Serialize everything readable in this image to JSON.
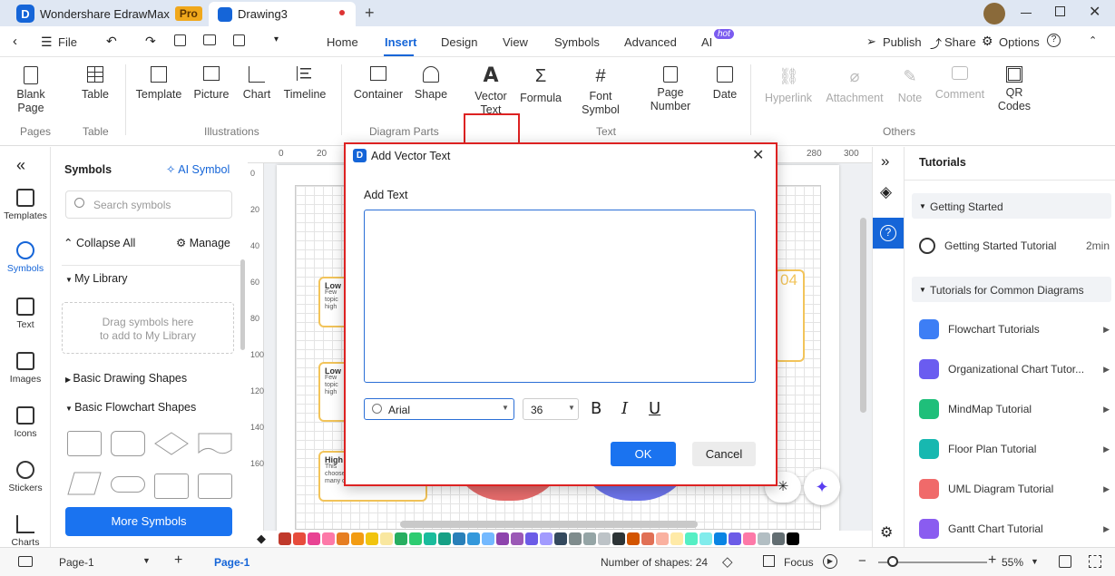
{
  "titlebar": {
    "app_name": "Wondershare EdrawMax",
    "pro_badge": "Pro",
    "doc_tab": "Drawing3",
    "new_tab": "+"
  },
  "menu": {
    "file": "File",
    "tabs": [
      "Home",
      "Insert",
      "Design",
      "View",
      "Symbols",
      "Advanced",
      "AI"
    ],
    "ai_badge": "hot",
    "publish": "Publish",
    "share": "Share",
    "options": "Options"
  },
  "ribbon": {
    "blank_page": [
      "Blank",
      "Page"
    ],
    "table": "Table",
    "template": "Template",
    "picture": "Picture",
    "chart": "Chart",
    "timeline": "Timeline",
    "container": "Container",
    "shape": "Shape",
    "vector_text": [
      "Vector",
      "Text"
    ],
    "formula": "Formula",
    "font_symbol": [
      "Font",
      "Symbol"
    ],
    "page_number": [
      "Page",
      "Number"
    ],
    "date": "Date",
    "hyperlink": "Hyperlink",
    "attachment": "Attachment",
    "note": "Note",
    "comment": "Comment",
    "qr_codes": [
      "QR",
      "Codes"
    ],
    "groups": {
      "pages": "Pages",
      "table": "Table",
      "illustrations": "Illustrations",
      "diagram_parts": "Diagram Parts",
      "text": "Text",
      "others": "Others"
    }
  },
  "leftbar": [
    "Templates",
    "Symbols",
    "Text",
    "Images",
    "Icons",
    "Stickers",
    "Charts"
  ],
  "symbols": {
    "title": "Symbols",
    "ai_symbol": "AI Symbol",
    "search_placeholder": "Search symbols",
    "collapse_all": "Collapse All",
    "manage": "Manage",
    "my_library": "My Library",
    "drop_hint": [
      "Drag symbols here",
      "to add to My Library"
    ],
    "basic_drawing": "Basic Drawing Shapes",
    "basic_flowchart": "Basic Flowchart Shapes",
    "more_symbols": "More Symbols"
  },
  "canvas": {
    "ruler_top": [
      "0",
      "20",
      "280",
      "300"
    ],
    "ruler_left": [
      "0",
      "20",
      "40",
      "60",
      "80",
      "100",
      "120",
      "140",
      "160"
    ],
    "cards": [
      {
        "title": "Low",
        "lines": [
          "Few",
          "topic",
          "high"
        ]
      },
      {
        "title": "Low",
        "lines": [
          "Few",
          "topic",
          "high"
        ]
      },
      {
        "title": "High",
        "lines": [
          "This",
          "choose this topic, you have",
          "many competitors."
        ]
      }
    ],
    "card_number": "04"
  },
  "dialog": {
    "title": "Add Vector Text",
    "label": "Add Text",
    "text_value": "",
    "font": "Arial",
    "size": "36",
    "bold": "B",
    "italic": "I",
    "underline": "U",
    "ok": "OK",
    "cancel": "Cancel"
  },
  "tutorials": {
    "title": "Tutorials",
    "getting_started_section": "Getting Started",
    "getting_started_item": "Getting Started Tutorial",
    "getting_started_duration": "2min",
    "common_section": "Tutorials for Common Diagrams",
    "items": [
      {
        "label": "Flowchart Tutorials",
        "color": "#3d7ef5"
      },
      {
        "label": "Organizational Chart Tutor...",
        "color": "#6a5cf0"
      },
      {
        "label": "MindMap Tutorial",
        "color": "#1fbf7a"
      },
      {
        "label": "Floor Plan Tutorial",
        "color": "#17b8b0"
      },
      {
        "label": "UML Diagram Tutorial",
        "color": "#f06a6a"
      },
      {
        "label": "Gantt Chart Tutorial",
        "color": "#8a5cf0"
      }
    ]
  },
  "status": {
    "page_selector": "Page-1",
    "add_page": "+",
    "active_page": "Page-1",
    "shapes_count": "Number of shapes: 24",
    "focus": "Focus",
    "zoom": "55%"
  },
  "palette": [
    "#c0392b",
    "#e74c3c",
    "#e84393",
    "#fd79a8",
    "#e67e22",
    "#f39c12",
    "#f1c40f",
    "#f9e79f",
    "#27ae60",
    "#2ecc71",
    "#1abc9c",
    "#16a085",
    "#2980b9",
    "#3498db",
    "#74b9ff",
    "#8e44ad",
    "#9b59b6",
    "#6c5ce7",
    "#a29bfe",
    "#34495e",
    "#7f8c8d",
    "#95a5a6",
    "#bdc3c7",
    "#2d3436",
    "#d35400",
    "#e17055",
    "#fab1a0",
    "#ffeaa7",
    "#55efc4",
    "#81ecec",
    "#0984e3",
    "#6c5ce7",
    "#fd79a8",
    "#b2bec3",
    "#636e72",
    "#000000"
  ]
}
